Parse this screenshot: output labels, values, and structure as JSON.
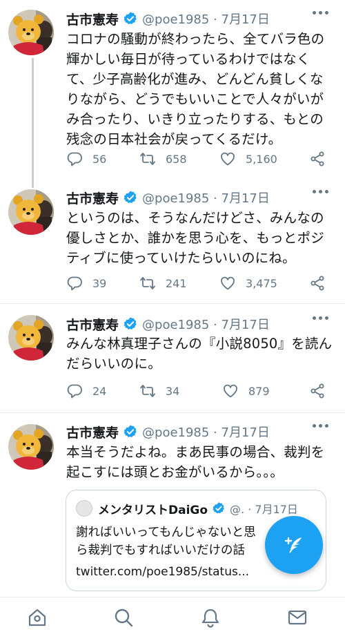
{
  "tweets": [
    {
      "name": "古市憲寿",
      "handle": "@poe1985 · 7月17日",
      "lines": [
        "コロナの騒動が終わったら、全てバラ色の",
        "輝かしい毎日が待っているわけではなく",
        "て、少子高齢化が進み、どんどん貧しくな",
        "りながら、どうでもいいことで人々がいが",
        "み合ったり、いきり立ったりする、もとの",
        "残念の日本社会が戻ってくるだけ。"
      ],
      "replies": "56",
      "retweets": "658",
      "likes": "5,160"
    },
    {
      "name": "古市憲寿",
      "handle": "@poe1985 · 7月17日",
      "lines": [
        "というのは、そうなんだけどさ、みんなの",
        "優しさとか、誰かを思う心を、もっとポジ",
        "ティブに使っていけたらいいのにね。"
      ],
      "replies": "39",
      "retweets": "241",
      "likes": "3,475"
    },
    {
      "name": "古市憲寿",
      "handle": "@poe1985 · 7月17日",
      "lines": [
        "みんな林真理子さんの『小説8050』を読ん",
        "だらいいのに。"
      ],
      "replies": "24",
      "retweets": "34",
      "likes": "879"
    },
    {
      "name": "古市憲寿",
      "handle": "@poe1985 · 7月17日",
      "lines": [
        "本当そうだよね。まあ民事の場合、裁判を",
        "起こすには頭とお金がいるから。。。"
      ]
    }
  ],
  "quote": {
    "name": "メンタリストDaiGo",
    "handle": "@. · 7月17日",
    "lines": [
      "謝ればいいってもんじゃないと思",
      "ら裁判でもすればいいだけの話"
    ],
    "link": "twitter.com/poe1985/status..."
  },
  "colors": {
    "accent": "#1da1f2",
    "secondary_text": "#657786",
    "border": "#e6ecf0"
  },
  "icons": {
    "reply": "reply-icon",
    "retweet": "retweet-icon",
    "like": "heart-icon",
    "share": "share-icon",
    "compose": "compose-tweet-icon",
    "nav": [
      "home-icon",
      "search-icon",
      "notifications-icon",
      "messages-icon"
    ]
  }
}
